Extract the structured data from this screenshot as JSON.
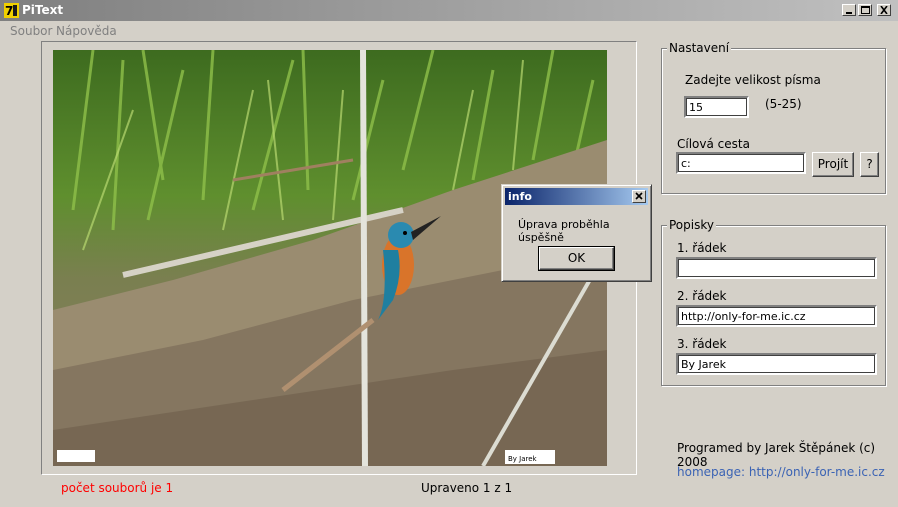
{
  "window": {
    "title": "PiText",
    "icon": "pitext-app-icon"
  },
  "menu": {
    "items": [
      {
        "label": "Soubor"
      },
      {
        "label": "Nápověda"
      }
    ]
  },
  "photo": {
    "watermark_left": "",
    "watermark_right": "By Jarek"
  },
  "settings": {
    "legend": "Nastavení",
    "font_size_label": "Zadejte velikost písma",
    "font_size_value": "15",
    "font_size_range": "(5-25)",
    "target_path_label": "Cílová cesta",
    "target_path_value": "c:",
    "browse_label": "Projít",
    "help_label": "?"
  },
  "captions": {
    "legend": "Popisky",
    "line1_label": "1. řádek",
    "line1_value": "",
    "line2_label": "2. řádek",
    "line2_value": "http://only-for-me.ic.cz",
    "line3_label": "3. řádek",
    "line3_value": "By Jarek"
  },
  "footer": {
    "credits": "Programed by Jarek Štěpánek (c) 2008",
    "homepage": "homepage: http://only-for-me.ic.cz",
    "file_count": "počet souborů je 1",
    "progress_text": "Upraveno 1 z 1"
  },
  "dialog": {
    "title": "info",
    "message": "Úprava proběhla úspěšně",
    "ok_label": "OK"
  },
  "colors": {
    "status_red": "#ff0000",
    "link_blue": "#3b63b4",
    "dialog_title": "#0a246a"
  }
}
